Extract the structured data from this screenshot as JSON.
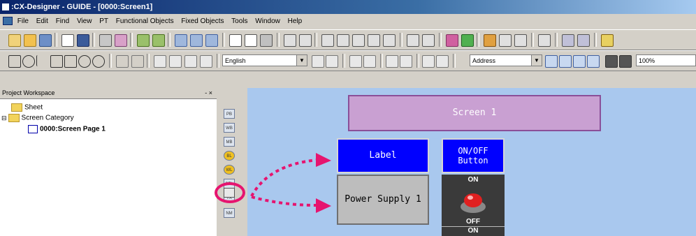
{
  "window": {
    "title": ":CX-Designer - GUIDE - [0000:Screen1]"
  },
  "menu": [
    "File",
    "Edit",
    "Find",
    "View",
    "PT",
    "Functional Objects",
    "Fixed Objects",
    "Tools",
    "Window",
    "Help"
  ],
  "toolbar": {
    "language": "English",
    "address_mode": "Address",
    "zoom": "100%"
  },
  "project_workspace": {
    "title": "Project Workspace",
    "controls": "- ×",
    "tree": [
      {
        "label": "Sheet"
      },
      {
        "label": "Screen Category"
      },
      {
        "label": "0000:Screen Page 1"
      }
    ]
  },
  "object_toolbar": [
    "PB",
    "WB",
    "MB",
    "BL",
    "WL",
    "SEL",
    "TX",
    "NM"
  ],
  "canvas": {
    "screen_label": "Screen 1",
    "label_object": "Label",
    "onoff_button": [
      "ON/OFF",
      "Button"
    ],
    "power_supply": "Power Supply 1",
    "switch_on": "ON",
    "switch_off": "OFF",
    "switch_on2": "ON"
  },
  "colors": {
    "accent": "#e6146f",
    "label_bg": "#0000ff",
    "screen_bg": "#c9a0d2",
    "canvas_bg": "#a9c8ee"
  }
}
